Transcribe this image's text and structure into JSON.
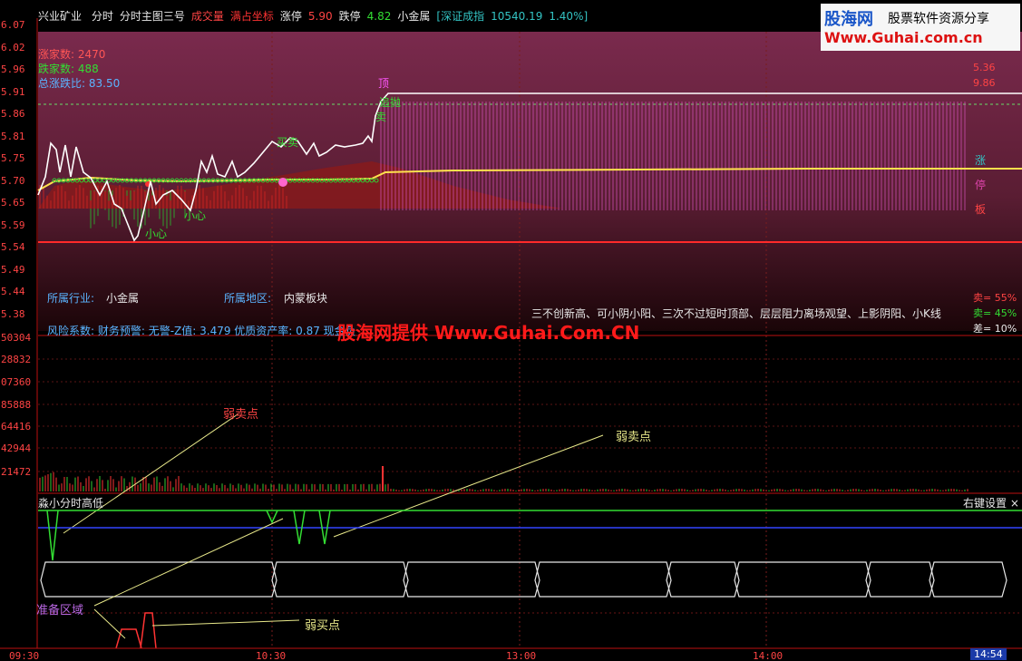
{
  "header": {
    "stock_name": "兴业矿业",
    "items": [
      {
        "text": "分时",
        "color": "#e8e8e8"
      },
      {
        "text": "分时主图三号",
        "color": "#e8e8e8"
      },
      {
        "text": "成交量",
        "color": "#ff4444"
      },
      {
        "text": "满占坐标",
        "color": "#ff3333"
      },
      {
        "text": "涨停",
        "color": "#e8e8e8"
      },
      {
        "text": "5.90",
        "color": "#ff4444"
      },
      {
        "text": "跌停",
        "color": "#e8e8e8"
      },
      {
        "text": "4.82",
        "color": "#33dd33"
      },
      {
        "text": "小金属",
        "color": "#e8e8e8"
      },
      {
        "text": "[深证成指",
        "color": "#33c3c3"
      },
      {
        "text": "10540.19",
        "color": "#33c3c3"
      },
      {
        "text": "1.40%]",
        "color": "#33c3c3"
      }
    ]
  },
  "logo": {
    "line1": "股海网",
    "line2": "股票软件资源分享",
    "line3": "Www.Guhai.com.cn"
  },
  "price_axis": [
    "6.07",
    "6.02",
    "5.96",
    "5.91",
    "5.86",
    "5.81",
    "5.75",
    "5.70",
    "5.65",
    "5.59",
    "5.54",
    "5.49",
    "5.44",
    "5.38"
  ],
  "volume_axis": [
    "50304",
    "28832",
    "07360",
    "85888",
    "64416",
    "42944",
    "21472"
  ],
  "time_axis": [
    "09:30",
    "10:30",
    "13:00",
    "14:00"
  ],
  "current_time": "14:54",
  "stats": [
    {
      "label": "涨家数:",
      "value": "2470",
      "color": "#ff5555"
    },
    {
      "label": "跌家数:",
      "value": "488",
      "color": "#33dd33"
    },
    {
      "label": "总涨跌比:",
      "value": "83.50",
      "color": "#5ab4ff"
    }
  ],
  "right_values": [
    "5.36",
    "9.86"
  ],
  "annotations": {
    "top": "顶",
    "chase1": "追抛",
    "chase2": "卖",
    "buy": "买卖",
    "careful1": "小心",
    "careful2": "小心"
  },
  "limit_up_vertical": [
    "涨",
    "停",
    "板"
  ],
  "info": {
    "industry_label": "所属行业:",
    "industry_value": "小金属",
    "region_label": "所属地区:",
    "region_value": "内蒙板块",
    "risk_text": "风险系数: 财务预警: 无警-Z值: 3.479 优质资产率: 0.87 现金负",
    "scroll_text": "三不创新高、可小阴小阳、三次不过短时顶部、层层阻力离场观望、上影阴阳、小K线",
    "sell": "卖= 55%",
    "sell2": "卖= 45%",
    "diff": "差= 10%"
  },
  "watermark": "股海网提供 Www.Guhai.Com.CN",
  "volume_labels": {
    "weak_sell_1": "弱卖点",
    "weak_sell_2": "弱卖点"
  },
  "indicator": {
    "title": "淼小分时高低",
    "settings": "右键设置 ×",
    "prepare_zone": "准备区域",
    "weak_buy": "弱买点"
  }
}
